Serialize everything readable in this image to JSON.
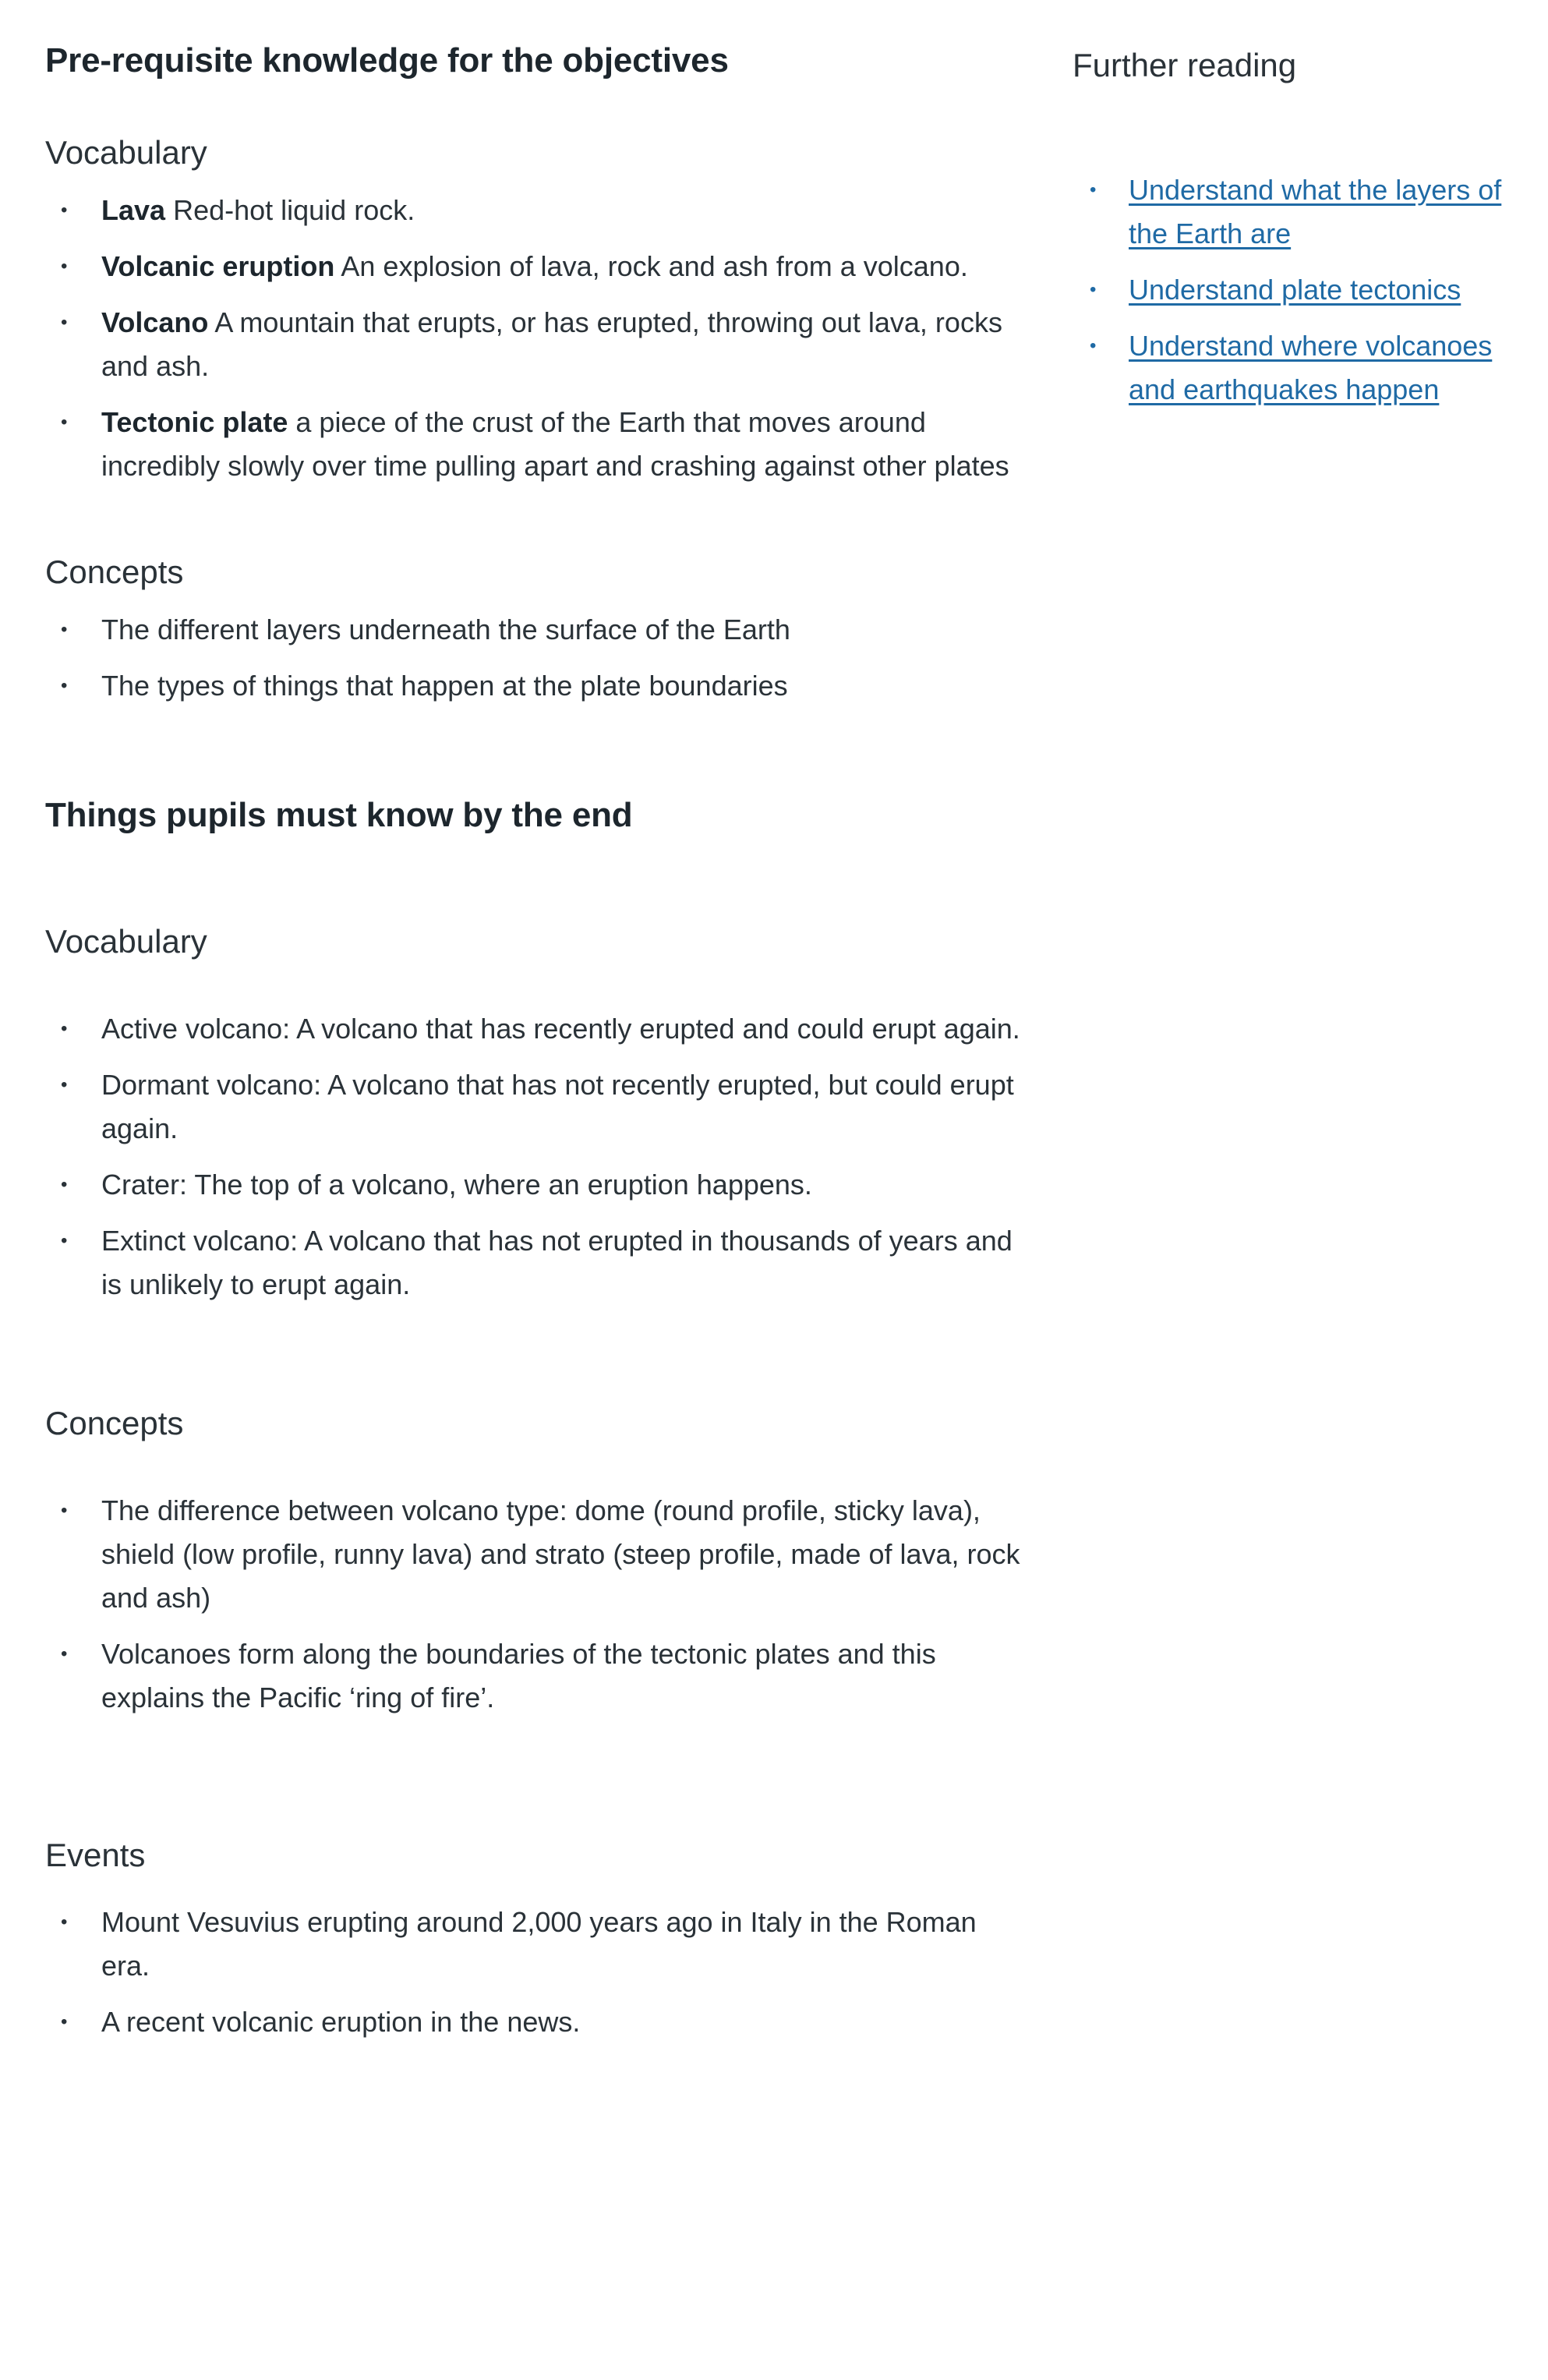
{
  "prerequisite": {
    "title": "Pre-requisite knowledge for the objectives",
    "vocabulary": {
      "heading": "Vocabulary",
      "items": [
        {
          "term": "Lava",
          "text": " Red-hot liquid rock."
        },
        {
          "term": "Volcanic eruption",
          "text": " An explosion of lava, rock and ash from a volcano."
        },
        {
          "term": "Volcano",
          "text": " A mountain that erupts, or has erupted, throwing out lava, rocks and ash."
        },
        {
          "term": "Tectonic plate",
          "text": " a piece of the crust of the Earth that moves around incredibly slowly over time pulling apart and crashing against other plates"
        }
      ]
    },
    "concepts": {
      "heading": "Concepts",
      "items": [
        "The different layers underneath the surface of the Earth",
        "The types of things that happen at the plate boundaries"
      ]
    }
  },
  "end": {
    "title": "Things pupils must know by the end",
    "vocabulary": {
      "heading": "Vocabulary",
      "items": [
        "Active volcano: A volcano that has recently erupted and could erupt again.",
        "Dormant volcano: A volcano that has not recently erupted, but could erupt again.",
        "Crater: The top of a volcano, where an eruption happens.",
        "Extinct volcano: A volcano that has not erupted in thousands of years and is unlikely to erupt again."
      ]
    },
    "concepts": {
      "heading": "Concepts",
      "items": [
        "The difference between volcano type: dome (round profile, sticky lava), shield (low profile, runny lava) and strato (steep profile, made of lava, rock and ash)",
        "Volcanoes form along the boundaries of the tectonic plates and this explains the Pacific ‘ring of fire’."
      ]
    },
    "events": {
      "heading": "Events",
      "items": [
        "Mount Vesuvius erupting around 2,000 years ago in Italy in the Roman era.",
        "A recent volcanic eruption in the news."
      ]
    }
  },
  "further_reading": {
    "heading": "Further reading",
    "links": [
      "Understand what the layers of the Earth are",
      "Understand plate tectonics",
      "Understand where volcanoes and earthquakes happen"
    ]
  },
  "colors": {
    "text": "#2a3238",
    "heading": "#1d262d",
    "link": "#1f6aa5",
    "background": "#ffffff"
  }
}
